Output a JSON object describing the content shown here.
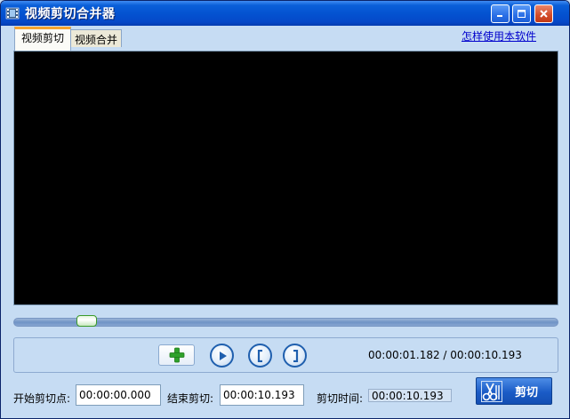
{
  "window": {
    "title": "视频剪切合并器"
  },
  "tabs": [
    {
      "label": "视频剪切",
      "active": true
    },
    {
      "label": "视频合并",
      "active": false
    }
  ],
  "help_link": "怎样使用本软件",
  "timeline": {
    "position_fraction": 0.116
  },
  "playback": {
    "time_display": "00:00:01.182 / 00:00:10.193"
  },
  "fields": {
    "start_label": "开始剪切点:",
    "start_value": "00:00:00.000",
    "end_label": "结束剪切:",
    "end_value": "00:00:10.193",
    "duration_label": "剪切时间:",
    "duration_value": "00:00:10.193"
  },
  "cut_button": {
    "label": "剪切",
    "icon": "scissors-icon"
  },
  "icons": {
    "app": "film-icon",
    "add": "plus-icon",
    "play": "play-icon",
    "mark_start": "bracket-left-icon",
    "mark_end": "bracket-right-icon"
  },
  "colors": {
    "titlebar": "#0453d1",
    "background": "#c6dcf3",
    "video": "#000000",
    "cut_button": "#1a5bc6",
    "add_icon": "#2fa12a"
  }
}
